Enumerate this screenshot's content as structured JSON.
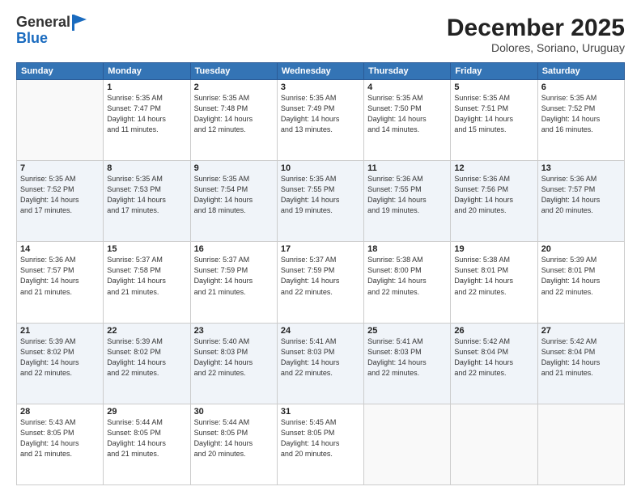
{
  "header": {
    "logo_line1": "General",
    "logo_line2": "Blue",
    "month": "December 2025",
    "location": "Dolores, Soriano, Uruguay"
  },
  "days_of_week": [
    "Sunday",
    "Monday",
    "Tuesday",
    "Wednesday",
    "Thursday",
    "Friday",
    "Saturday"
  ],
  "weeks": [
    [
      {
        "day": "",
        "info": ""
      },
      {
        "day": "1",
        "info": "Sunrise: 5:35 AM\nSunset: 7:47 PM\nDaylight: 14 hours\nand 11 minutes."
      },
      {
        "day": "2",
        "info": "Sunrise: 5:35 AM\nSunset: 7:48 PM\nDaylight: 14 hours\nand 12 minutes."
      },
      {
        "day": "3",
        "info": "Sunrise: 5:35 AM\nSunset: 7:49 PM\nDaylight: 14 hours\nand 13 minutes."
      },
      {
        "day": "4",
        "info": "Sunrise: 5:35 AM\nSunset: 7:50 PM\nDaylight: 14 hours\nand 14 minutes."
      },
      {
        "day": "5",
        "info": "Sunrise: 5:35 AM\nSunset: 7:51 PM\nDaylight: 14 hours\nand 15 minutes."
      },
      {
        "day": "6",
        "info": "Sunrise: 5:35 AM\nSunset: 7:52 PM\nDaylight: 14 hours\nand 16 minutes."
      }
    ],
    [
      {
        "day": "7",
        "info": "Sunrise: 5:35 AM\nSunset: 7:52 PM\nDaylight: 14 hours\nand 17 minutes."
      },
      {
        "day": "8",
        "info": "Sunrise: 5:35 AM\nSunset: 7:53 PM\nDaylight: 14 hours\nand 17 minutes."
      },
      {
        "day": "9",
        "info": "Sunrise: 5:35 AM\nSunset: 7:54 PM\nDaylight: 14 hours\nand 18 minutes."
      },
      {
        "day": "10",
        "info": "Sunrise: 5:35 AM\nSunset: 7:55 PM\nDaylight: 14 hours\nand 19 minutes."
      },
      {
        "day": "11",
        "info": "Sunrise: 5:36 AM\nSunset: 7:55 PM\nDaylight: 14 hours\nand 19 minutes."
      },
      {
        "day": "12",
        "info": "Sunrise: 5:36 AM\nSunset: 7:56 PM\nDaylight: 14 hours\nand 20 minutes."
      },
      {
        "day": "13",
        "info": "Sunrise: 5:36 AM\nSunset: 7:57 PM\nDaylight: 14 hours\nand 20 minutes."
      }
    ],
    [
      {
        "day": "14",
        "info": "Sunrise: 5:36 AM\nSunset: 7:57 PM\nDaylight: 14 hours\nand 21 minutes."
      },
      {
        "day": "15",
        "info": "Sunrise: 5:37 AM\nSunset: 7:58 PM\nDaylight: 14 hours\nand 21 minutes."
      },
      {
        "day": "16",
        "info": "Sunrise: 5:37 AM\nSunset: 7:59 PM\nDaylight: 14 hours\nand 21 minutes."
      },
      {
        "day": "17",
        "info": "Sunrise: 5:37 AM\nSunset: 7:59 PM\nDaylight: 14 hours\nand 22 minutes."
      },
      {
        "day": "18",
        "info": "Sunrise: 5:38 AM\nSunset: 8:00 PM\nDaylight: 14 hours\nand 22 minutes."
      },
      {
        "day": "19",
        "info": "Sunrise: 5:38 AM\nSunset: 8:01 PM\nDaylight: 14 hours\nand 22 minutes."
      },
      {
        "day": "20",
        "info": "Sunrise: 5:39 AM\nSunset: 8:01 PM\nDaylight: 14 hours\nand 22 minutes."
      }
    ],
    [
      {
        "day": "21",
        "info": "Sunrise: 5:39 AM\nSunset: 8:02 PM\nDaylight: 14 hours\nand 22 minutes."
      },
      {
        "day": "22",
        "info": "Sunrise: 5:39 AM\nSunset: 8:02 PM\nDaylight: 14 hours\nand 22 minutes."
      },
      {
        "day": "23",
        "info": "Sunrise: 5:40 AM\nSunset: 8:03 PM\nDaylight: 14 hours\nand 22 minutes."
      },
      {
        "day": "24",
        "info": "Sunrise: 5:41 AM\nSunset: 8:03 PM\nDaylight: 14 hours\nand 22 minutes."
      },
      {
        "day": "25",
        "info": "Sunrise: 5:41 AM\nSunset: 8:03 PM\nDaylight: 14 hours\nand 22 minutes."
      },
      {
        "day": "26",
        "info": "Sunrise: 5:42 AM\nSunset: 8:04 PM\nDaylight: 14 hours\nand 22 minutes."
      },
      {
        "day": "27",
        "info": "Sunrise: 5:42 AM\nSunset: 8:04 PM\nDaylight: 14 hours\nand 21 minutes."
      }
    ],
    [
      {
        "day": "28",
        "info": "Sunrise: 5:43 AM\nSunset: 8:05 PM\nDaylight: 14 hours\nand 21 minutes."
      },
      {
        "day": "29",
        "info": "Sunrise: 5:44 AM\nSunset: 8:05 PM\nDaylight: 14 hours\nand 21 minutes."
      },
      {
        "day": "30",
        "info": "Sunrise: 5:44 AM\nSunset: 8:05 PM\nDaylight: 14 hours\nand 20 minutes."
      },
      {
        "day": "31",
        "info": "Sunrise: 5:45 AM\nSunset: 8:05 PM\nDaylight: 14 hours\nand 20 minutes."
      },
      {
        "day": "",
        "info": ""
      },
      {
        "day": "",
        "info": ""
      },
      {
        "day": "",
        "info": ""
      }
    ]
  ]
}
